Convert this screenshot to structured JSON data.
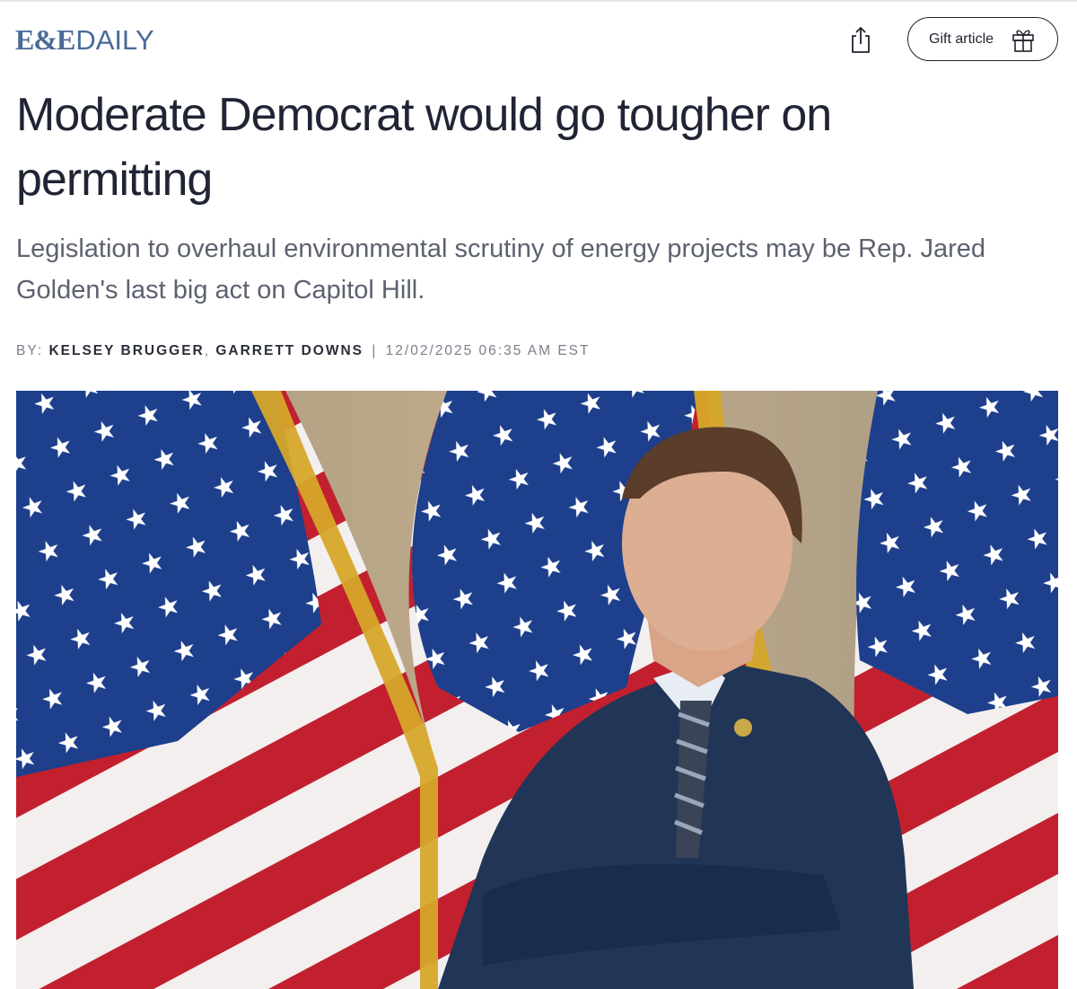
{
  "brand": {
    "logo_bold": "E&E",
    "logo_light": "DAILY"
  },
  "actions": {
    "gift_label": "Gift article"
  },
  "article": {
    "headline": "Moderate Democrat would go tougher on permitting",
    "dek": "Legislation to overhaul environmental scrutiny of energy projects may be Rep. Jared Golden's last big act on Capitol Hill.",
    "byline_prefix": "BY:",
    "authors": [
      "KELSEY BRUGGER",
      "GARRETT DOWNS"
    ],
    "author_separator": ",",
    "divider": "|",
    "timestamp": "12/02/2025 06:35 AM EST"
  },
  "icons": {
    "share": "share-icon",
    "gift": "gift-icon"
  },
  "colors": {
    "brand_blue": "#4a6b96",
    "headline": "#202434",
    "dek": "#5d6270",
    "byline_meta": "#7a7f8a"
  }
}
